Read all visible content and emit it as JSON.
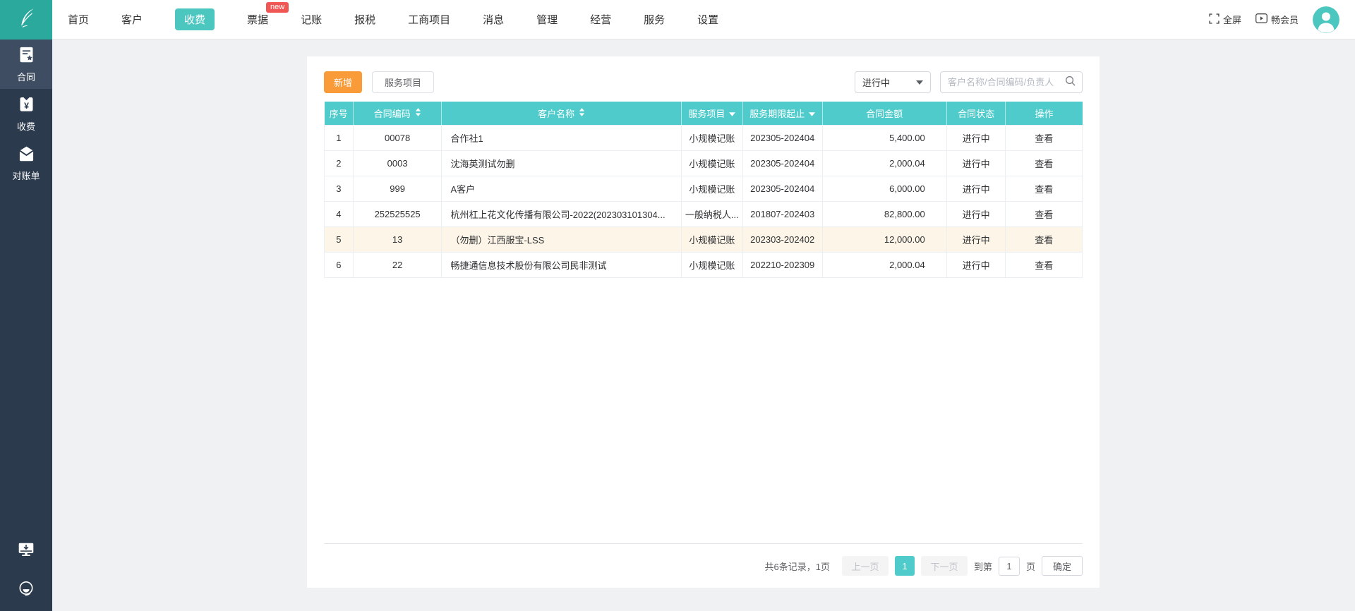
{
  "colors": {
    "accent_teal": "#4ecbca",
    "brand_teal": "#2ba99d",
    "nav_active_teal": "#4cc7c0",
    "sidebar_navy": "#2c3a4d",
    "sidebar_active_navy": "#3e4d61",
    "add_button_orange": "#f99b38",
    "badge_red": "#f05654",
    "highlight_row_yellow": "#fdf6e8"
  },
  "topbar": {
    "nav": [
      {
        "label": "首页"
      },
      {
        "label": "客户"
      },
      {
        "label": "收费",
        "active": true
      },
      {
        "label": "票据",
        "badge": "new"
      },
      {
        "label": "记账"
      },
      {
        "label": "报税"
      },
      {
        "label": "工商项目"
      },
      {
        "label": "消息"
      },
      {
        "label": "管理"
      },
      {
        "label": "经营"
      },
      {
        "label": "服务"
      },
      {
        "label": "设置"
      }
    ],
    "fullscreen_label": "全屏",
    "member_label": "畅会员"
  },
  "sidebar": {
    "items": [
      {
        "label": "合同",
        "icon": "contract-doc-star-icon",
        "active": true
      },
      {
        "label": "收费",
        "icon": "yuan-badge-icon"
      },
      {
        "label": "对账单",
        "icon": "statement-envelope-icon"
      }
    ],
    "bottom_icons": [
      "client-download-icon",
      "customer-service-icon"
    ]
  },
  "toolbar": {
    "add_label": "新增",
    "service_items_label": "服务项目",
    "status_filter_value": "进行中",
    "search_placeholder": "客户名称/合同编码/负责人"
  },
  "table": {
    "columns": [
      {
        "label": "序号"
      },
      {
        "label": "合同编码",
        "sorter": "sortable"
      },
      {
        "label": "客户名称",
        "sorter": "sortable"
      },
      {
        "label": "服务项目",
        "sorter": "filter"
      },
      {
        "label": "服务期限起止",
        "sorter": "filter"
      },
      {
        "label": "合同金额"
      },
      {
        "label": "合同状态"
      },
      {
        "label": "操作"
      }
    ],
    "rows": [
      {
        "no": "1",
        "code": "00078",
        "customer": "合作社1",
        "service": "小规模记账",
        "period": "202305-202404",
        "amount": "5,400.00",
        "status": "进行中",
        "action": "查看"
      },
      {
        "no": "2",
        "code": "0003",
        "customer": "沈海英测试勿删",
        "service": "小规模记账",
        "period": "202305-202404",
        "amount": "2,000.04",
        "status": "进行中",
        "action": "查看"
      },
      {
        "no": "3",
        "code": "999",
        "customer": "A客户",
        "service": "小规模记账",
        "period": "202305-202404",
        "amount": "6,000.00",
        "status": "进行中",
        "action": "查看"
      },
      {
        "no": "4",
        "code": "252525525",
        "customer": "杭州杠上花文化传播有限公司-2022(202303101304...",
        "service": "一般纳税人...",
        "period": "201807-202403",
        "amount": "82,800.00",
        "status": "进行中",
        "action": "查看"
      },
      {
        "no": "5",
        "code": "13",
        "customer": "（勿删）江西服宝-LSS",
        "service": "小规模记账",
        "period": "202303-202402",
        "amount": "12,000.00",
        "status": "进行中",
        "action": "查看",
        "highlighted": true
      },
      {
        "no": "6",
        "code": "22",
        "customer": "畅捷通信息技术股份有限公司民非测试",
        "service": "小规模记账",
        "period": "202210-202309",
        "amount": "2,000.04",
        "status": "进行中",
        "action": "查看"
      }
    ]
  },
  "pagination": {
    "summary": "共6条记录，1页",
    "prev_label": "上一页",
    "current_page": "1",
    "next_label": "下一页",
    "goto_prefix": "到第",
    "goto_value": "1",
    "goto_suffix": "页",
    "confirm_label": "确定"
  }
}
